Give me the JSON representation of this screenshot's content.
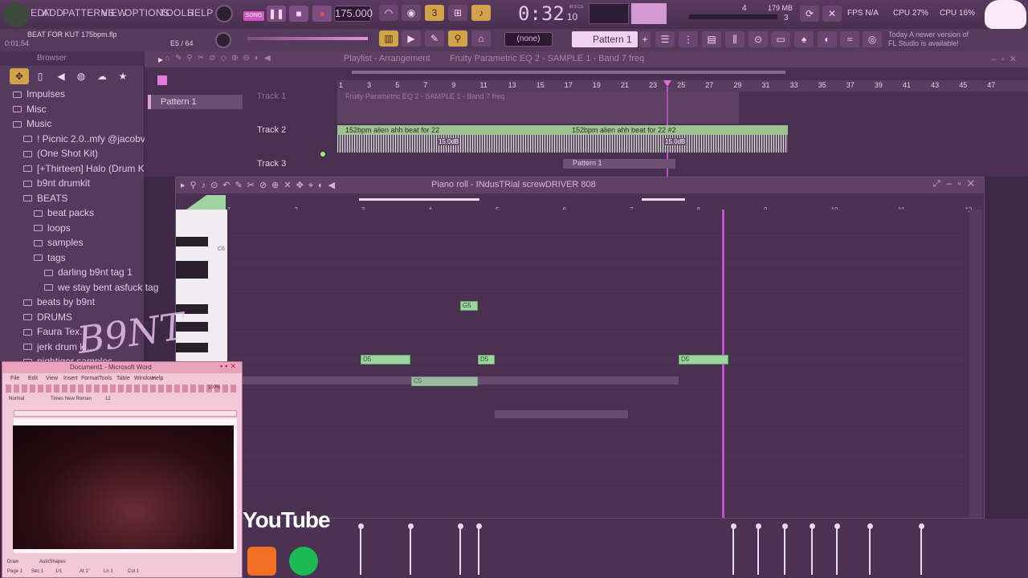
{
  "menu": {
    "items": [
      "EDIT",
      "ADD",
      "PATTERNS",
      "VIEW",
      "OPTIONS",
      "TOOLS",
      "HELP"
    ],
    "song_label": "SONG",
    "tempo": "175.000",
    "time": "0:32",
    "time_ms": "10",
    "time_unit": "M:S:CS",
    "memory": "179 MB",
    "poly": "4",
    "poly2": "3",
    "fps": "FPS N/A",
    "cpu1": "CPU 27%",
    "cpu2": "CPU 16%",
    "project": "BEAT FOR KUT 175bpm.flp",
    "project_time": "0:01:54",
    "step_pos": "E5 / 64",
    "snap": "(none)",
    "pattern": "Pattern 1",
    "update_note_l1": "Today  A newer version of",
    "update_note_l2": "FL Studio is available!"
  },
  "browser": {
    "title": "Browser",
    "items": [
      {
        "label": "Impulses",
        "indent": 0
      },
      {
        "label": "Misc",
        "indent": 0
      },
      {
        "label": "Music",
        "indent": 0
      },
      {
        "label": "! Picnic 2.0..mfy @jacobvj1)",
        "indent": 1
      },
      {
        "label": "(One Shot Kit)",
        "indent": 1
      },
      {
        "label": "[+Thirteen] Halo (Drum Kit)",
        "indent": 1
      },
      {
        "label": "b9nt drumkit",
        "indent": 1
      },
      {
        "label": "BEATS",
        "indent": 1
      },
      {
        "label": "beat packs",
        "indent": 2
      },
      {
        "label": "loops",
        "indent": 2
      },
      {
        "label": "samples",
        "indent": 2
      },
      {
        "label": "tags",
        "indent": 2
      },
      {
        "label": "darling b9nt tag 1",
        "indent": 3
      },
      {
        "label": "we stay bent asfuck tag",
        "indent": 3
      },
      {
        "label": "beats by b9nt",
        "indent": 1
      },
      {
        "label": "DRUMS",
        "indent": 1
      },
      {
        "label": "Faura Tex...",
        "indent": 1
      },
      {
        "label": "jerk drum ki...",
        "indent": 1
      },
      {
        "label": "nightiger samples",
        "indent": 1
      }
    ]
  },
  "playlist": {
    "title": "Playlist - Arrangement",
    "subtitle": "Fruity Parametric EQ 2 - SAMPLE 1 - Band 7 freq",
    "pattern_item": "Pattern 1",
    "ruler": [
      "1",
      "3",
      "5",
      "7",
      "9",
      "11",
      "13",
      "15",
      "17",
      "19",
      "21",
      "23",
      "25",
      "27",
      "29",
      "31",
      "33",
      "35",
      "37",
      "39",
      "41",
      "43",
      "45",
      "47"
    ],
    "tracks": [
      "Track 1",
      "Track 2",
      "Track 3"
    ],
    "automation_clip": "Fruity Parametric EQ 2 - SAMPLE 1 - Band 7 freq",
    "clips": [
      {
        "label": "152bpm alien ahh beat for  22",
        "gain": "15.0dB"
      },
      {
        "label": "152bpm alien ahh beat for  22 #2",
        "gain": "15.0dB"
      }
    ],
    "pattern_clip": "Pattern 1"
  },
  "pianoroll": {
    "title": "Piano roll - INdusTRial screwDRIVER 808",
    "ruler": [
      "1",
      "2",
      "3",
      "4",
      "5",
      "6",
      "7",
      "8",
      "9",
      "10",
      "11",
      "12"
    ],
    "key_label": "C6",
    "notes": [
      {
        "label": "G5"
      },
      {
        "label": "D5"
      },
      {
        "label": "D5"
      },
      {
        "label": "D5"
      },
      {
        "label": "C5"
      }
    ]
  },
  "word": {
    "title": "Document1 - Microsoft Word",
    "menu": [
      "File",
      "Edit",
      "View",
      "Insert",
      "Format",
      "Tools",
      "Table",
      "Window",
      "Help"
    ],
    "style": "Normal",
    "font": "Times New Roman",
    "size": "12",
    "zoom": "100%",
    "status": [
      "Page 1",
      "Sec 1",
      "1/1",
      "At 1\"",
      "Ln 1",
      "Col 1"
    ],
    "draw": "Draw",
    "autoshapes": "AutoShapes"
  },
  "overlay": {
    "logo_text": "B9NT",
    "youtube": "YouTube"
  },
  "colors": {
    "accent": "#e56dd8",
    "note": "#9ed4a0",
    "clip": "#9ec391",
    "playhead": "#c64fd0"
  },
  "icons": [
    "cpu-icon",
    "piano-icon",
    "play-icon",
    "stop-icon",
    "record-icon",
    "snap-icon",
    "magnet-icon",
    "pencil-icon",
    "folder-icon",
    "close-icon",
    "minimize-icon",
    "maximize-icon",
    "youtube-logo",
    "soundcloud-logo",
    "spotify-logo",
    "hello-kitty-icon"
  ]
}
